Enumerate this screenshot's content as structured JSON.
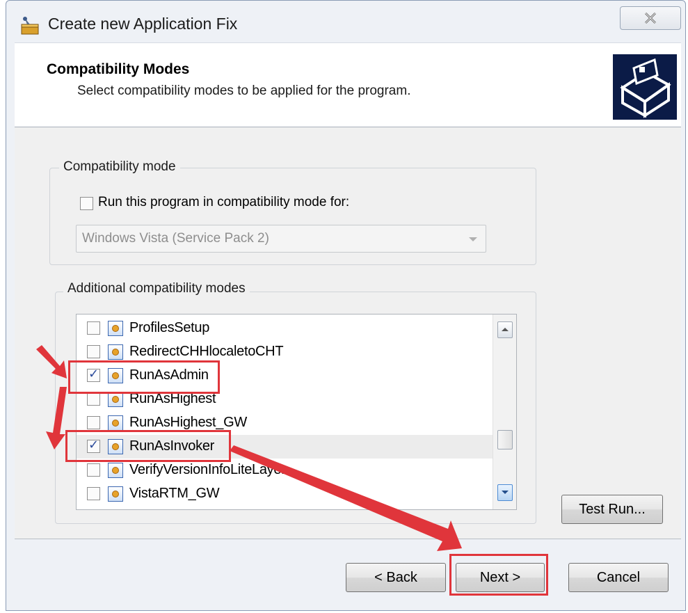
{
  "window": {
    "title": "Create new Application Fix"
  },
  "header": {
    "title": "Compatibility Modes",
    "subtitle": "Select compatibility modes to be applied for the program."
  },
  "compat_group": {
    "legend": "Compatibility mode",
    "checkbox_label": "Run this program in compatibility mode for:",
    "checkbox_checked": false,
    "dropdown_value": "Windows Vista (Service Pack 2)",
    "dropdown_enabled": false
  },
  "additional_group": {
    "legend": "Additional compatibility modes",
    "items": [
      {
        "label": "ProfilesSetup",
        "checked": false
      },
      {
        "label": "RedirectCHHlocaletoCHT",
        "checked": false
      },
      {
        "label": "RunAsAdmin",
        "checked": true
      },
      {
        "label": "RunAsHighest",
        "checked": false
      },
      {
        "label": "RunAsHighest_GW",
        "checked": false
      },
      {
        "label": "RunAsInvoker",
        "checked": true
      },
      {
        "label": "VerifyVersionInfoLiteLayer",
        "checked": false
      },
      {
        "label": "VistaRTM_GW",
        "checked": false
      }
    ]
  },
  "buttons": {
    "test_run": "Test Run...",
    "back": "< Back",
    "next": "Next >",
    "cancel": "Cancel"
  },
  "annotation_color": "#e0353b"
}
